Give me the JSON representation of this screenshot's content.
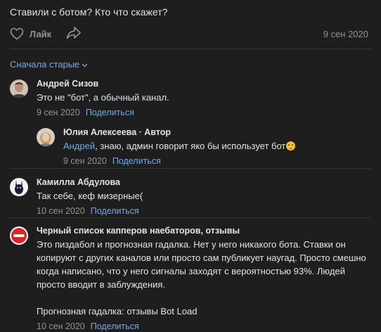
{
  "post": {
    "text": "Ставили с ботом? Кто что скажет?",
    "like_label": "Лайк",
    "date": "9 сен 2020"
  },
  "sort_label": "Сначала старые",
  "comments": [
    {
      "author": "Андрей Сизов",
      "text": "Это не \"бот\", а обычный канал.",
      "date": "9 сен 2020",
      "share_label": "Поделиться"
    },
    {
      "author": "Юлия Алексеева · Автор",
      "mention": "Андрей",
      "text": ", знаю, админ говорит яко бы использует бот",
      "emoji": "face-with-tongue-icon",
      "date": "9 сен 2020",
      "share_label": "Поделиться"
    },
    {
      "author": "Камилла Абдулова",
      "text": "Так себе, кеф мизерные(",
      "date": "10 сен 2020",
      "share_label": "Поделиться"
    },
    {
      "author": "Черный список капперов наебаторов, отзывы",
      "text": "Это пиздабол и прогнозная гадалка. Нет у него никакого бота. Ставки он копируют с других каналов или просто сам публикует наугад. Просто смешно когда написано, что у него сигналы заходят с вероятностью 93%. Людей просто вводит в заблуждения.\n\nПрогнозная гадалка: отзывы Bot Load",
      "date": "10 сен 2020",
      "share_label": "Поделиться"
    }
  ],
  "colors": {
    "background": "#1e1e1e",
    "text": "#e1e3e6",
    "secondary": "#939393",
    "link": "#71aaeb"
  }
}
